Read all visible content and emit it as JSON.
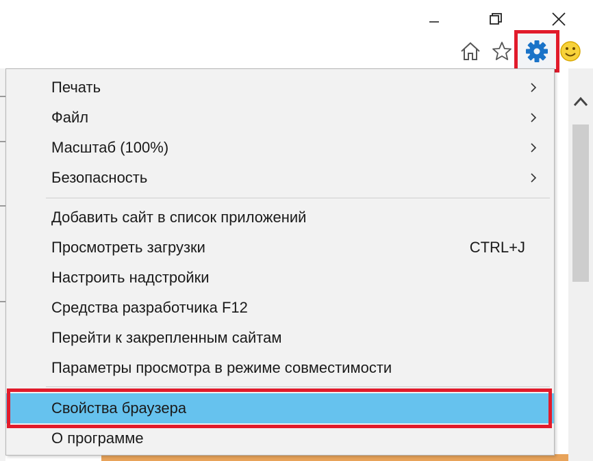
{
  "window": {
    "minimize_icon": "minimize-icon",
    "restore_icon": "restore-icon",
    "close_icon": "close-icon"
  },
  "toolbar": {
    "home_icon": "home-icon",
    "favorites_icon": "star-icon",
    "tools_icon": "gear-icon",
    "feedback_icon": "smiley-icon",
    "accent": "#1a73c8",
    "highlight_border": "#e11b2b"
  },
  "menu": {
    "items_top": [
      {
        "label": "Печать",
        "has_submenu": true
      },
      {
        "label": "Файл",
        "has_submenu": true
      },
      {
        "label": "Масштаб (100%)",
        "has_submenu": true
      },
      {
        "label": "Безопасность",
        "has_submenu": true
      }
    ],
    "items_middle": [
      {
        "label": "Добавить сайт в список приложений"
      },
      {
        "label": "Просмотреть загрузки",
        "shortcut": "CTRL+J"
      },
      {
        "label": "Настроить надстройки"
      },
      {
        "label": "Средства разработчика F12"
      },
      {
        "label": "Перейти к закрепленным сайтам"
      },
      {
        "label": "Параметры просмотра в режиме совместимости"
      }
    ],
    "items_bottom": [
      {
        "label": "Свойства браузера",
        "highlighted": true
      },
      {
        "label": "О программе"
      }
    ],
    "highlight_color": "#66c2ee"
  }
}
